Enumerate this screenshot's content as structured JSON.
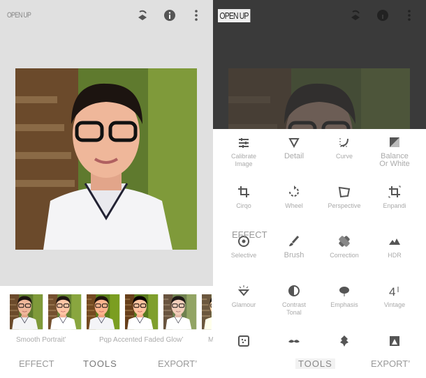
{
  "left": {
    "app_title": "OPEN UP",
    "filters": [
      "Smooth Portrait",
      "Pop Accented Faded Glow",
      "M"
    ],
    "filter_labels": [
      "Smooth Portrait’",
      "Pqp Accented Faded Glow’",
      "M"
    ],
    "nav": {
      "effect": "EFFECT",
      "tools": "TOOLS",
      "export": "EXPORT’"
    }
  },
  "right": {
    "app_title": "OPEN UP",
    "tools": [
      {
        "label": "Calibrate",
        "label2": "Image",
        "icon": "tune-icon"
      },
      {
        "label": "Detail",
        "icon": "triangle-icon"
      },
      {
        "label": "Curve",
        "icon": "curve-icon"
      },
      {
        "label": "Balance",
        "label2": "Or White",
        "icon": "white-balance-icon"
      },
      {
        "label": "Cirqo",
        "icon": "crop-icon"
      },
      {
        "label": "Wheel",
        "icon": "rotate-icon"
      },
      {
        "label": "Perspective",
        "icon": "perspective-icon"
      },
      {
        "label": "Enpandi",
        "icon": "expand-icon"
      },
      {
        "label": "Selective",
        "icon": "selective-icon"
      },
      {
        "label": "Brush",
        "icon": "brush-icon"
      },
      {
        "label": "Correction",
        "icon": "healing-icon"
      },
      {
        "label": "HDR",
        "icon": "hdr-icon"
      },
      {
        "label": "Glamour",
        "icon": "glamour-icon"
      },
      {
        "label": "Contrast",
        "label2": "Tonal",
        "icon": "tonal-contrast-icon"
      },
      {
        "label": "Emphasis",
        "icon": "drama-icon"
      },
      {
        "label": "Vintage",
        "icon": "vintage-icon"
      },
      {
        "label": "",
        "icon": "grainy-icon"
      },
      {
        "label": "",
        "icon": "mustache-icon"
      },
      {
        "label": "",
        "icon": "grunge-icon"
      },
      {
        "label": "",
        "icon": "bw-icon"
      }
    ],
    "nav": {
      "effect": "EFFECT",
      "tools": "TOOLS",
      "export": "EXPORT’"
    }
  }
}
